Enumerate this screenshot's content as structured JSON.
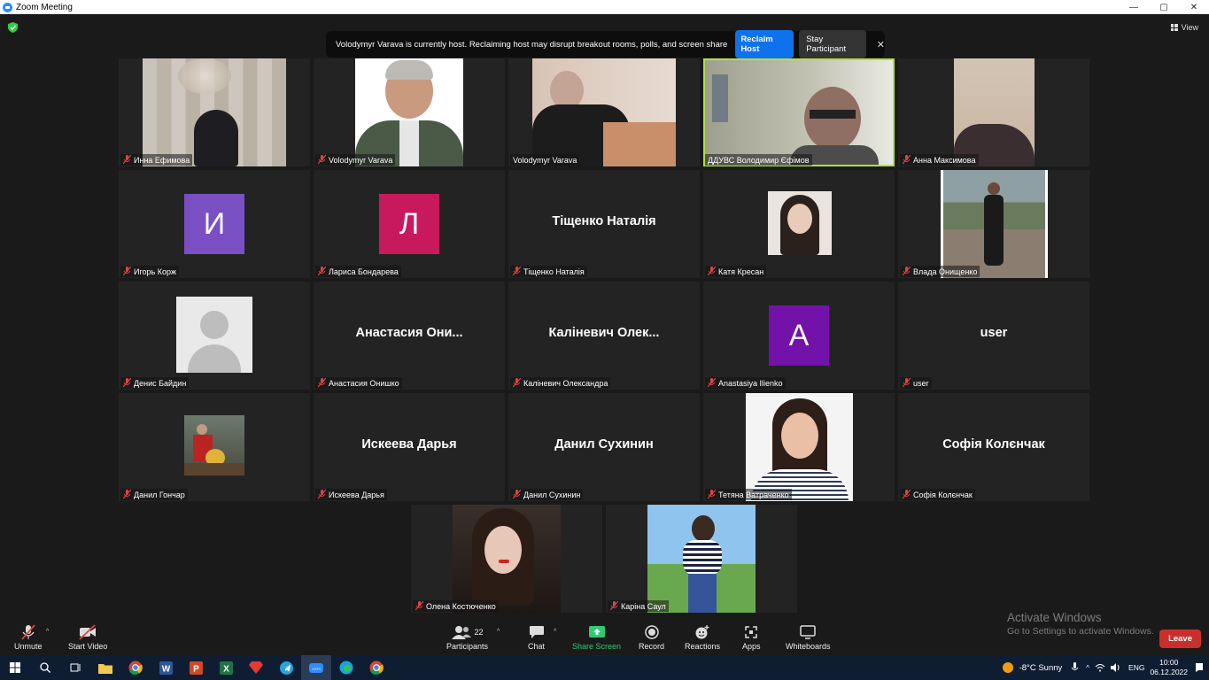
{
  "window": {
    "title": "Zoom Meeting",
    "controls": [
      "—",
      "▢",
      "✕"
    ]
  },
  "view_label": "View",
  "banner": {
    "message": "Volodymyr Varava is currently host. Reclaiming host may disrupt breakout rooms, polls, and screen share",
    "reclaim": "Reclaim Host",
    "stay": "Stay Participant",
    "close": "✕"
  },
  "tiles": [
    {
      "name": "Инна Ефимова",
      "kind": "photo"
    },
    {
      "name": "Volodymyr Varava",
      "kind": "photo"
    },
    {
      "name": "Volodymyr Varava",
      "kind": "photo"
    },
    {
      "name": "ДДУВС Володимир Єфімов",
      "kind": "photo",
      "active": true
    },
    {
      "name": "Анна Максимова",
      "kind": "photo"
    },
    {
      "name": "Игорь Корж",
      "kind": "letter",
      "letter": "И",
      "color": "#7a4fc4"
    },
    {
      "name": "Лариса Бондарева",
      "kind": "letter",
      "letter": "Л",
      "color": "#c8195c"
    },
    {
      "name": "Тіщенко Наталія",
      "kind": "text",
      "big": "Тіщенко Наталія"
    },
    {
      "name": "Катя Кресан",
      "kind": "photo"
    },
    {
      "name": "Влада Онищенко",
      "kind": "photo"
    },
    {
      "name": "Денис Байдин",
      "kind": "default-avatar"
    },
    {
      "name": "Анастасия Онишко",
      "kind": "text",
      "big": "Анастасия Они..."
    },
    {
      "name": "Каліневич Олександра",
      "kind": "text",
      "big": "Каліневич Олек..."
    },
    {
      "name": "Anastasiya Ilienko",
      "kind": "letter",
      "letter": "A",
      "color": "#7212a8"
    },
    {
      "name": "user",
      "kind": "text",
      "big": "user"
    },
    {
      "name": "Данил Гончар",
      "kind": "photo"
    },
    {
      "name": "Искеева Дарья",
      "kind": "text",
      "big": "Искеева Дарья"
    },
    {
      "name": "Данил Сухинин",
      "kind": "text",
      "big": "Данил Сухинин"
    },
    {
      "name": "Тетяна Ватраченко",
      "kind": "photo"
    },
    {
      "name": "Софія Колєнчак",
      "kind": "text",
      "big": "Софія Колєнчак"
    },
    {
      "name": "Олена Костюченко",
      "kind": "photo"
    },
    {
      "name": "Каріна Саул",
      "kind": "photo"
    }
  ],
  "toolbar": {
    "unmute": "Unmute",
    "start_video": "Start Video",
    "participants": "Participants",
    "participants_count": "22",
    "chat": "Chat",
    "share_screen": "Share Screen",
    "record": "Record",
    "reactions": "Reactions",
    "apps": "Apps",
    "whiteboards": "Whiteboards",
    "leave": "Leave"
  },
  "watermark": {
    "line1": "Activate Windows",
    "line2": "Go to Settings to activate Windows."
  },
  "taskbar": {
    "weather": "-8°C  Sunny",
    "lang": "ENG",
    "time": "10:00",
    "date": "06.12.2022"
  },
  "colors": {
    "accent": "#0e72ed",
    "share": "#2ecc71",
    "leave": "#c9302c",
    "active_border": "#b3e03a"
  }
}
